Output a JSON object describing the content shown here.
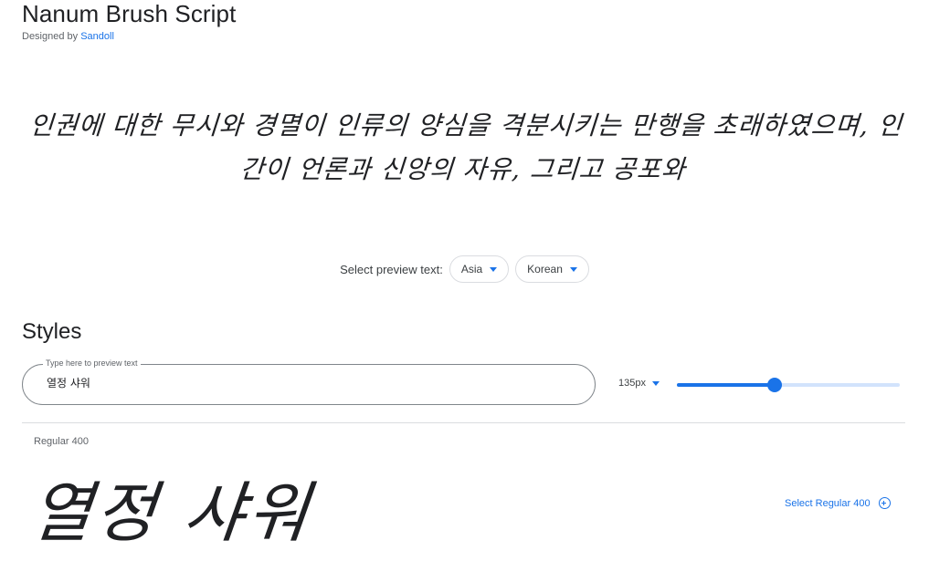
{
  "header": {
    "font_name": "Nanum Brush Script",
    "designed_by_label": "Designed by",
    "designer": "Sandoll"
  },
  "sample": {
    "text": "인권에 대한 무시와 경멸이 인류의 양심을 격분시키는 만행을 초래하였으며, 인간이 언론과 신앙의 자유, 그리고 공포와"
  },
  "preview_select": {
    "label": "Select preview text:",
    "region": "Asia",
    "language": "Korean"
  },
  "styles": {
    "heading": "Styles",
    "preview_input_label": "Type here to preview text",
    "preview_input_value": "열정 샤워",
    "size_label": "135px",
    "size_fraction": 0.44,
    "items": [
      {
        "name": "Regular 400",
        "preview": "열정 샤워",
        "select_label": "Select Regular 400"
      }
    ]
  },
  "colors": {
    "accent": "#1a73e8",
    "text": "#202124",
    "muted": "#5f6368"
  }
}
